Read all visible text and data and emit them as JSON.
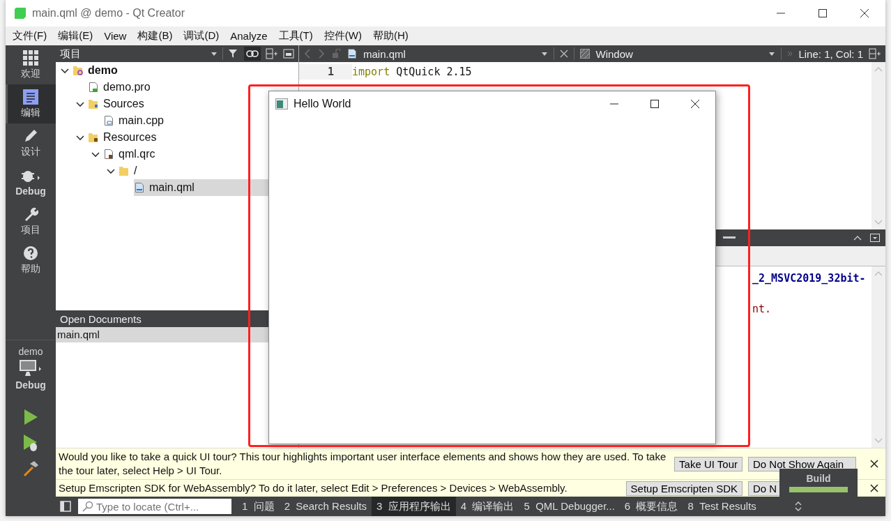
{
  "window": {
    "title": "main.qml @ demo - Qt Creator"
  },
  "menu": [
    "文件(F)",
    "编辑(E)",
    "View",
    "构建(B)",
    "调试(D)",
    "Analyze",
    "工具(T)",
    "控件(W)",
    "帮助(H)"
  ],
  "modes": [
    {
      "label": "欢迎",
      "kind": "welcome",
      "selected": false
    },
    {
      "label": "编辑",
      "kind": "edit",
      "selected": true
    },
    {
      "label": "设计",
      "kind": "design",
      "selected": false
    },
    {
      "label": "Debug",
      "kind": "debug",
      "selected": false
    },
    {
      "label": "项目",
      "kind": "projects",
      "selected": false
    },
    {
      "label": "帮助",
      "kind": "help",
      "selected": false
    }
  ],
  "kit": {
    "project": "demo",
    "build": "Debug"
  },
  "project_panel": {
    "title": "项目",
    "tree": [
      {
        "label": "demo",
        "kind": "project",
        "expanded": true,
        "selected": false,
        "children": [
          {
            "label": "demo.pro",
            "kind": "pro",
            "selected": false
          },
          {
            "label": "Sources",
            "kind": "sources",
            "expanded": true,
            "selected": false,
            "children": [
              {
                "label": "main.cpp",
                "kind": "cpp",
                "selected": false
              }
            ]
          },
          {
            "label": "Resources",
            "kind": "resources",
            "expanded": true,
            "selected": false,
            "children": [
              {
                "label": "qml.qrc",
                "kind": "qrc",
                "expanded": true,
                "selected": false,
                "children": [
                  {
                    "label": "/",
                    "kind": "folder",
                    "expanded": true,
                    "selected": false,
                    "children": [
                      {
                        "label": "main.qml",
                        "kind": "qml",
                        "selected": true
                      }
                    ]
                  }
                ]
              }
            ]
          }
        ]
      }
    ]
  },
  "open_documents": {
    "title": "Open Documents",
    "items": [
      {
        "label": "main.qml",
        "selected": true
      }
    ]
  },
  "editor": {
    "file": "main.qml",
    "symbol": "Window",
    "position": "Line: 1, Col: 1",
    "lines": [
      {
        "number": "1",
        "keyword": "import",
        "rest": "QtQuick 2.15"
      }
    ]
  },
  "output": {
    "lines": [
      {
        "text": "_2_MSVC2019_32bit-",
        "kind": "info"
      },
      {
        "text": "nt.",
        "kind": "error"
      }
    ]
  },
  "app_window": {
    "title": "Hello World"
  },
  "info_bars": [
    {
      "message": "Would you like to take a quick UI tour? This tour highlights important user interface elements and shows how they are used. To take the tour later, select Help > UI Tour.",
      "buttons": [
        "Take UI Tour",
        "Do Not Show Again"
      ]
    },
    {
      "message": "Setup Emscripten SDK for WebAssembly? To do it later, select Edit > Preferences > Devices > WebAssembly.",
      "buttons": [
        "Setup Emscripten SDK",
        "Do N"
      ]
    }
  ],
  "locator": {
    "placeholder": "Type to locate (Ctrl+..."
  },
  "output_tabs": [
    {
      "number": "1",
      "label": "问题",
      "selected": false
    },
    {
      "number": "2",
      "label": "Search Results",
      "selected": false
    },
    {
      "number": "3",
      "label": "应用程序输出",
      "selected": true
    },
    {
      "number": "4",
      "label": "编译输出",
      "selected": false
    },
    {
      "number": "5",
      "label": "QML Debugger...",
      "selected": false
    },
    {
      "number": "6",
      "label": "概要信息",
      "selected": false
    },
    {
      "number": "8",
      "label": "Test Results",
      "selected": false
    }
  ],
  "build_popup": {
    "title": "Build",
    "level": 1
  }
}
